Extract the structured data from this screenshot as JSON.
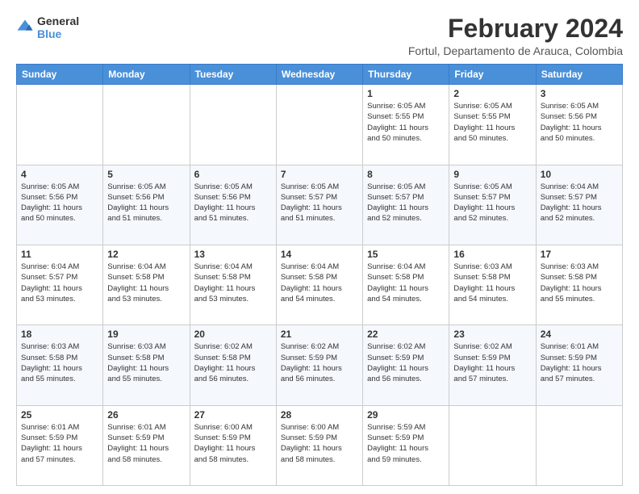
{
  "logo": {
    "line1": "General",
    "line2": "Blue"
  },
  "title": "February 2024",
  "subtitle": "Fortul, Departamento de Arauca, Colombia",
  "days_of_week": [
    "Sunday",
    "Monday",
    "Tuesday",
    "Wednesday",
    "Thursday",
    "Friday",
    "Saturday"
  ],
  "weeks": [
    [
      {
        "num": "",
        "detail": ""
      },
      {
        "num": "",
        "detail": ""
      },
      {
        "num": "",
        "detail": ""
      },
      {
        "num": "",
        "detail": ""
      },
      {
        "num": "1",
        "detail": "Sunrise: 6:05 AM\nSunset: 5:55 PM\nDaylight: 11 hours\nand 50 minutes."
      },
      {
        "num": "2",
        "detail": "Sunrise: 6:05 AM\nSunset: 5:55 PM\nDaylight: 11 hours\nand 50 minutes."
      },
      {
        "num": "3",
        "detail": "Sunrise: 6:05 AM\nSunset: 5:56 PM\nDaylight: 11 hours\nand 50 minutes."
      }
    ],
    [
      {
        "num": "4",
        "detail": "Sunrise: 6:05 AM\nSunset: 5:56 PM\nDaylight: 11 hours\nand 50 minutes."
      },
      {
        "num": "5",
        "detail": "Sunrise: 6:05 AM\nSunset: 5:56 PM\nDaylight: 11 hours\nand 51 minutes."
      },
      {
        "num": "6",
        "detail": "Sunrise: 6:05 AM\nSunset: 5:56 PM\nDaylight: 11 hours\nand 51 minutes."
      },
      {
        "num": "7",
        "detail": "Sunrise: 6:05 AM\nSunset: 5:57 PM\nDaylight: 11 hours\nand 51 minutes."
      },
      {
        "num": "8",
        "detail": "Sunrise: 6:05 AM\nSunset: 5:57 PM\nDaylight: 11 hours\nand 52 minutes."
      },
      {
        "num": "9",
        "detail": "Sunrise: 6:05 AM\nSunset: 5:57 PM\nDaylight: 11 hours\nand 52 minutes."
      },
      {
        "num": "10",
        "detail": "Sunrise: 6:04 AM\nSunset: 5:57 PM\nDaylight: 11 hours\nand 52 minutes."
      }
    ],
    [
      {
        "num": "11",
        "detail": "Sunrise: 6:04 AM\nSunset: 5:57 PM\nDaylight: 11 hours\nand 53 minutes."
      },
      {
        "num": "12",
        "detail": "Sunrise: 6:04 AM\nSunset: 5:58 PM\nDaylight: 11 hours\nand 53 minutes."
      },
      {
        "num": "13",
        "detail": "Sunrise: 6:04 AM\nSunset: 5:58 PM\nDaylight: 11 hours\nand 53 minutes."
      },
      {
        "num": "14",
        "detail": "Sunrise: 6:04 AM\nSunset: 5:58 PM\nDaylight: 11 hours\nand 54 minutes."
      },
      {
        "num": "15",
        "detail": "Sunrise: 6:04 AM\nSunset: 5:58 PM\nDaylight: 11 hours\nand 54 minutes."
      },
      {
        "num": "16",
        "detail": "Sunrise: 6:03 AM\nSunset: 5:58 PM\nDaylight: 11 hours\nand 54 minutes."
      },
      {
        "num": "17",
        "detail": "Sunrise: 6:03 AM\nSunset: 5:58 PM\nDaylight: 11 hours\nand 55 minutes."
      }
    ],
    [
      {
        "num": "18",
        "detail": "Sunrise: 6:03 AM\nSunset: 5:58 PM\nDaylight: 11 hours\nand 55 minutes."
      },
      {
        "num": "19",
        "detail": "Sunrise: 6:03 AM\nSunset: 5:58 PM\nDaylight: 11 hours\nand 55 minutes."
      },
      {
        "num": "20",
        "detail": "Sunrise: 6:02 AM\nSunset: 5:58 PM\nDaylight: 11 hours\nand 56 minutes."
      },
      {
        "num": "21",
        "detail": "Sunrise: 6:02 AM\nSunset: 5:59 PM\nDaylight: 11 hours\nand 56 minutes."
      },
      {
        "num": "22",
        "detail": "Sunrise: 6:02 AM\nSunset: 5:59 PM\nDaylight: 11 hours\nand 56 minutes."
      },
      {
        "num": "23",
        "detail": "Sunrise: 6:02 AM\nSunset: 5:59 PM\nDaylight: 11 hours\nand 57 minutes."
      },
      {
        "num": "24",
        "detail": "Sunrise: 6:01 AM\nSunset: 5:59 PM\nDaylight: 11 hours\nand 57 minutes."
      }
    ],
    [
      {
        "num": "25",
        "detail": "Sunrise: 6:01 AM\nSunset: 5:59 PM\nDaylight: 11 hours\nand 57 minutes."
      },
      {
        "num": "26",
        "detail": "Sunrise: 6:01 AM\nSunset: 5:59 PM\nDaylight: 11 hours\nand 58 minutes."
      },
      {
        "num": "27",
        "detail": "Sunrise: 6:00 AM\nSunset: 5:59 PM\nDaylight: 11 hours\nand 58 minutes."
      },
      {
        "num": "28",
        "detail": "Sunrise: 6:00 AM\nSunset: 5:59 PM\nDaylight: 11 hours\nand 58 minutes."
      },
      {
        "num": "29",
        "detail": "Sunrise: 5:59 AM\nSunset: 5:59 PM\nDaylight: 11 hours\nand 59 minutes."
      },
      {
        "num": "",
        "detail": ""
      },
      {
        "num": "",
        "detail": ""
      }
    ]
  ]
}
